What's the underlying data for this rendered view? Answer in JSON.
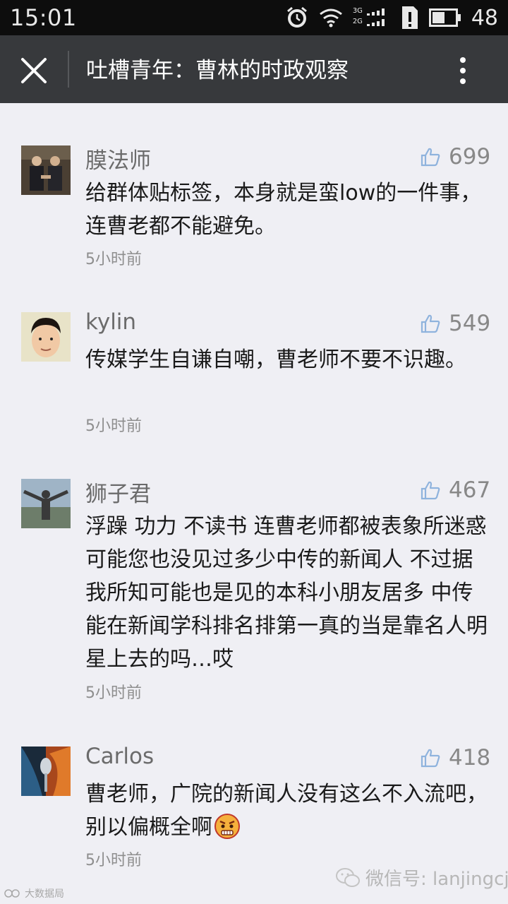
{
  "status_bar": {
    "time": "15:01",
    "battery": "48",
    "network_top": "3G",
    "network_bottom": "2G"
  },
  "app_bar": {
    "title": "吐槽青年：曹林的时政观察"
  },
  "comments": [
    {
      "name": "膜法师",
      "likes": "699",
      "text": "给群体贴标签，本身就是蛮low的一件事，连曹老都不能避免。",
      "time": "5小时前"
    },
    {
      "name": "kylin",
      "likes": "549",
      "text": "传媒学生自谦自嘲，曹老师不要不识趣。",
      "time": "5小时前"
    },
    {
      "name": "狮子君",
      "likes": "467",
      "text": "浮躁 功力 不读书 连曹老师都被表象所迷惑 可能您也没见过多少中传的新闻人 不过据我所知可能也是见的本科小朋友居多 中传能在新闻学科排名排第一真的当是靠名人明星上去的吗…哎",
      "time": "5小时前"
    },
    {
      "name": "Carlos",
      "likes": "418",
      "text": "曹老师，广院的新闻人没有这么不入流吧，别以偏概全啊",
      "time": "5小时前"
    }
  ],
  "watermark": {
    "text": "微信号: lanjingcj",
    "left_text": "大数据局"
  },
  "colors": {
    "status_bar": "#0d0d0d",
    "app_bar": "#37393c",
    "background": "#efeff4",
    "like_icon": "#8fb3dd"
  }
}
